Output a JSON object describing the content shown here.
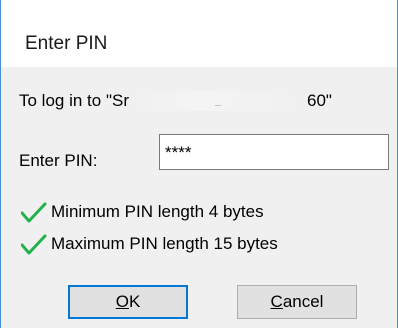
{
  "dialog": {
    "title": "Enter PIN"
  },
  "prompt": {
    "prefix": "To log in to \"Sr",
    "suffix": "60\""
  },
  "pin": {
    "label": "Enter PIN:",
    "value": "****"
  },
  "rules": [
    {
      "icon": "checkmark-icon",
      "text": "Minimum PIN length 4 bytes"
    },
    {
      "icon": "checkmark-icon",
      "text": "Maximum PIN length 15 bytes"
    }
  ],
  "buttons": {
    "ok": {
      "accel": "O",
      "rest": "K"
    },
    "cancel": {
      "accel": "C",
      "rest": "ancel"
    }
  },
  "colors": {
    "border_accent": "#4a8fd6",
    "default_button_border": "#0078d7",
    "check_green": "#22b14c",
    "client_background": "#f0f0f0"
  }
}
